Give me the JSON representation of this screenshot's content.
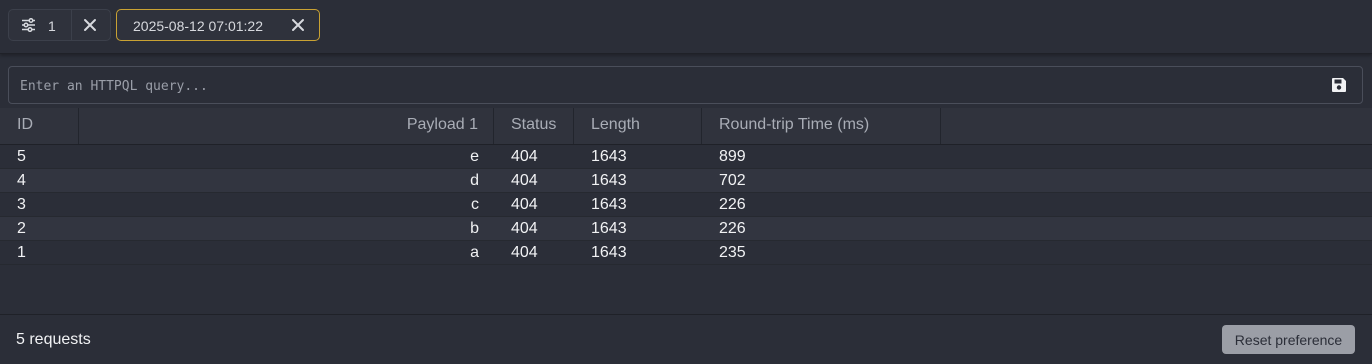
{
  "tabs": [
    {
      "label": "1",
      "icon": "sliders-icon",
      "active": false
    },
    {
      "label": "2025-08-12 07:01:22",
      "active": true
    }
  ],
  "query": {
    "placeholder": "Enter an HTTPQL query...",
    "value": ""
  },
  "table": {
    "columns": [
      "ID",
      "Payload 1",
      "Status",
      "Length",
      "Round-trip Time (ms)"
    ],
    "rows": [
      {
        "id": "5",
        "payload": "e",
        "status": "404",
        "length": "1643",
        "rtt": "899"
      },
      {
        "id": "4",
        "payload": "d",
        "status": "404",
        "length": "1643",
        "rtt": "702"
      },
      {
        "id": "3",
        "payload": "c",
        "status": "404",
        "length": "1643",
        "rtt": "226"
      },
      {
        "id": "2",
        "payload": "b",
        "status": "404",
        "length": "1643",
        "rtt": "226"
      },
      {
        "id": "1",
        "payload": "a",
        "status": "404",
        "length": "1643",
        "rtt": "235"
      }
    ]
  },
  "footer": {
    "count": "5 requests",
    "reset_label": "Reset preference"
  },
  "colors": {
    "active_tab_border": "#c9a233",
    "background": "#2b2e38",
    "reset_button": "#9b9ea6"
  }
}
